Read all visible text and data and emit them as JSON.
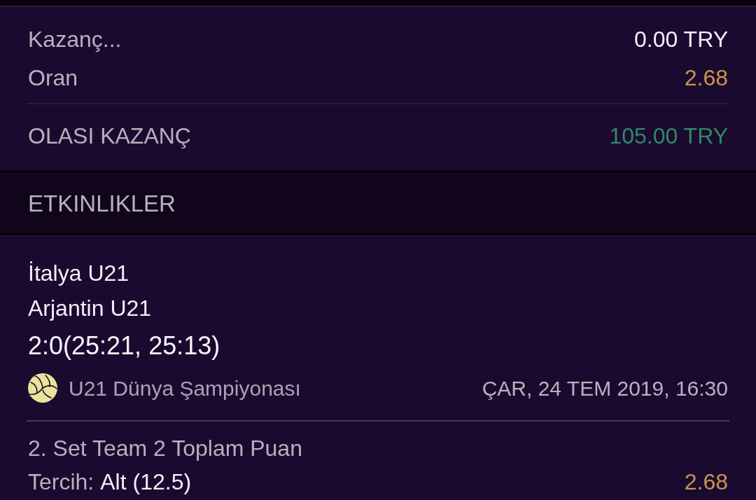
{
  "summary": {
    "rows": [
      {
        "label": "Kazanç...",
        "value": "0.00 TRY",
        "kind": "amount"
      },
      {
        "label": "Oran",
        "value": "2.68",
        "kind": "odds"
      }
    ],
    "total": {
      "label": "OLASI KAZANÇ",
      "value": "105.00 TRY"
    }
  },
  "events_section": {
    "title": "ETKINLIKLER"
  },
  "events": [
    {
      "home": "İtalya U21",
      "away": "Arjantin U21",
      "score": "2:0(25:21, 25:13)",
      "league": "U21 Dünya Şampiyonası",
      "datetime": "ÇAR, 24 TEM 2019, 16:30",
      "market": "2. Set Team 2 Toplam Puan",
      "pick_label": "Tercih:",
      "pick": "Alt (12.5)",
      "odds": "2.68"
    }
  ]
}
